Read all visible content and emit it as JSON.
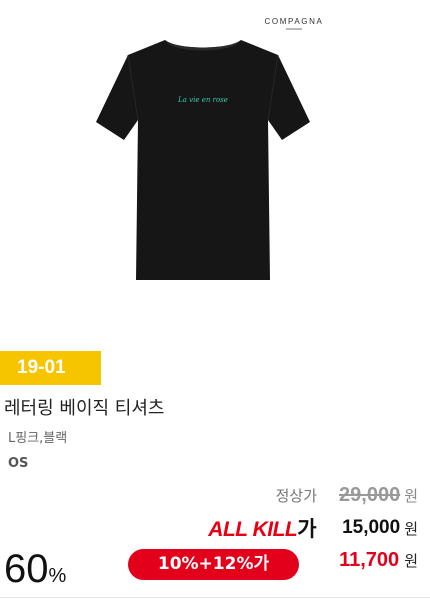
{
  "brand": {
    "name": "COMPAGNA",
    "shirt_print": "La vie en rose"
  },
  "product": {
    "code": "19-01",
    "name": "레터링 베이직 티셔츠",
    "color": "L핑크,블랙",
    "size": "OS"
  },
  "price": {
    "regular_label": "정상가",
    "regular_price": "29,000",
    "allkill_logo_text": "ALL KILL",
    "allkill_logo_suffix": "가",
    "allkill_price": "15,000",
    "discount_rate": "60",
    "discount_unit": "%",
    "coupon_label": "10%+12%가",
    "final_price": "11,700",
    "currency": "원"
  },
  "colors": {
    "badge": "#f7c400",
    "accent_red": "#e3001b",
    "shirt": "#161616",
    "print": "#3cc9a8"
  }
}
